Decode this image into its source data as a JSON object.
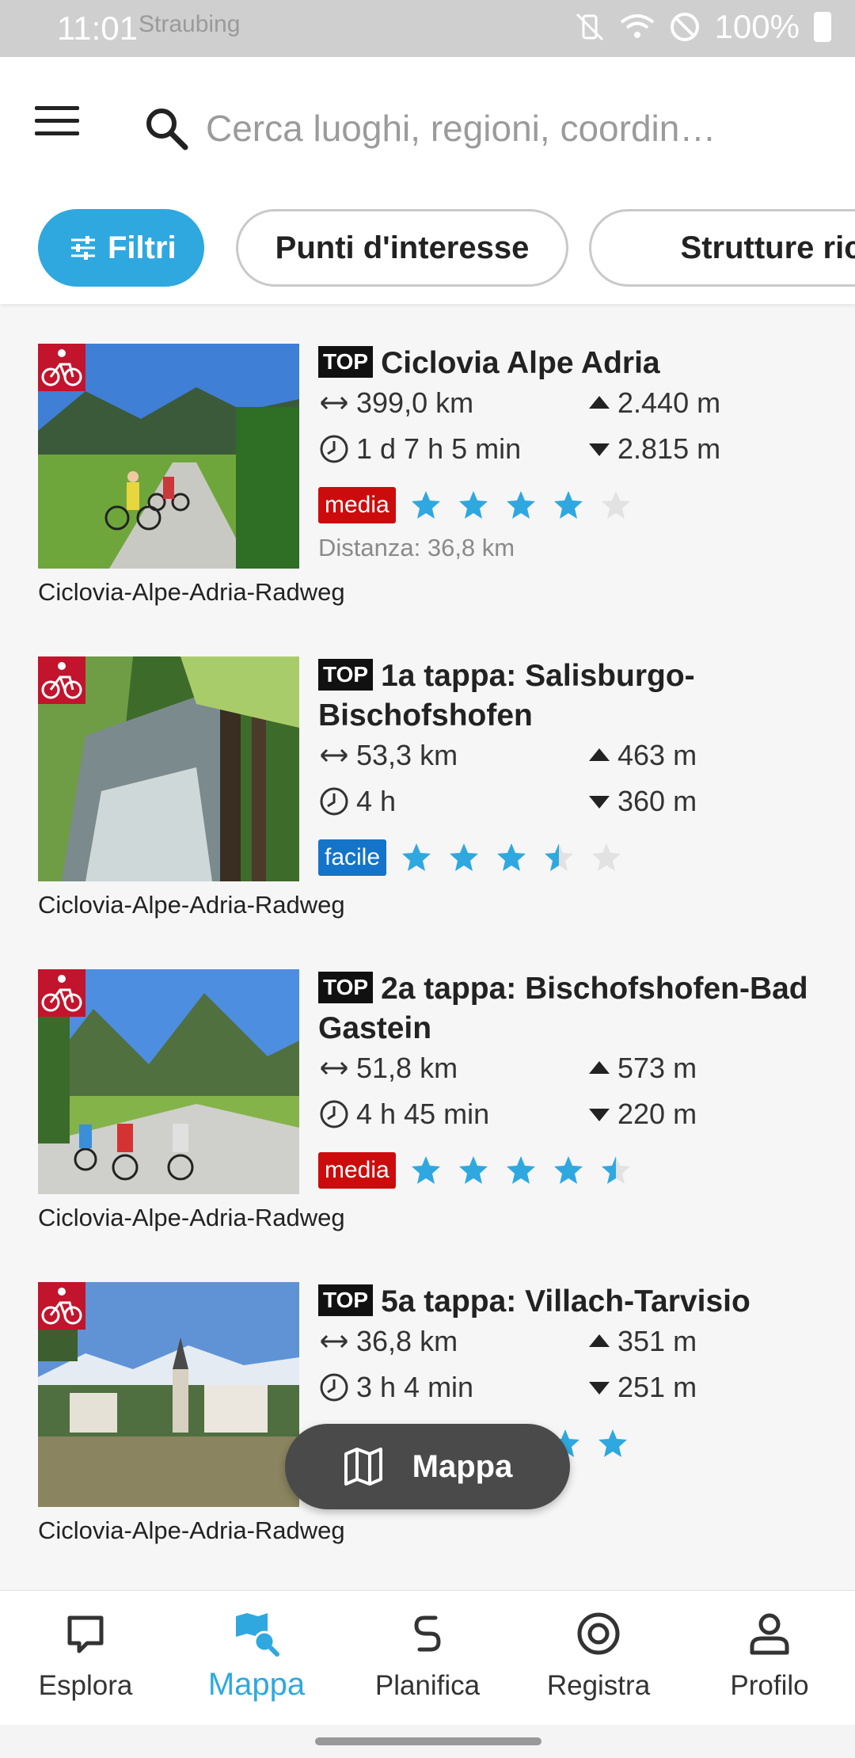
{
  "status_bar": {
    "time": "11:01",
    "battery": "100%",
    "map_ghost_text": "Straubing"
  },
  "search": {
    "placeholder": "Cerca luoghi, regioni, coordin…"
  },
  "chips": {
    "filters": "Filtri",
    "poi": "Punti d'interesse",
    "accommodation": "Strutture ricetti"
  },
  "tours": [
    {
      "top": "TOP",
      "title": "Ciclovia Alpe Adria",
      "distance": "399,0 km",
      "ascent": "2.440 m",
      "duration": "1 d 7 h 5 min",
      "descent": "2.815 m",
      "difficulty": "media",
      "difficulty_color": "#cc0c0c",
      "rating": 4,
      "away": "Distanza: 36,8 km",
      "source": "Ciclovia-Alpe-Adria-Radweg"
    },
    {
      "top": "TOP",
      "title": "1a tappa: Salisburgo-Bischofshofen",
      "distance": "53,3 km",
      "ascent": "463 m",
      "duration": "4 h",
      "descent": "360 m",
      "difficulty": "facile",
      "difficulty_color": "#1374c9",
      "rating": 3.5,
      "away": "",
      "source": "Ciclovia-Alpe-Adria-Radweg"
    },
    {
      "top": "TOP",
      "title": "2a tappa: Bischofshofen-Bad Gastein",
      "distance": "51,8 km",
      "ascent": "573 m",
      "duration": "4 h 45 min",
      "descent": "220 m",
      "difficulty": "media",
      "difficulty_color": "#cc0c0c",
      "rating": 4.5,
      "away": "",
      "source": "Ciclovia-Alpe-Adria-Radweg"
    },
    {
      "top": "TOP",
      "title": "5a tappa: Villach-Tarvisio",
      "distance": "36,8 km",
      "ascent": "351 m",
      "duration": "3 h 4 min",
      "descent": "251 m",
      "difficulty": "",
      "difficulty_color": "#1374c9",
      "rating": 5,
      "away": "",
      "source": "Ciclovia-Alpe-Adria-Radweg"
    }
  ],
  "map_button": {
    "label": "Mappa"
  },
  "bottom_nav": [
    {
      "label": "Esplora",
      "icon": "explore-icon",
      "active": false
    },
    {
      "label": "Mappa",
      "icon": "map-search-icon",
      "active": true
    },
    {
      "label": "Planifica",
      "icon": "route-plan-icon",
      "active": false
    },
    {
      "label": "Registra",
      "icon": "record-icon",
      "active": false
    },
    {
      "label": "Profilo",
      "icon": "profile-icon",
      "active": false
    }
  ],
  "colors": {
    "accent": "#2fa8e0",
    "star_filled": "#2fa8e0",
    "star_empty": "#e2e2e2"
  }
}
